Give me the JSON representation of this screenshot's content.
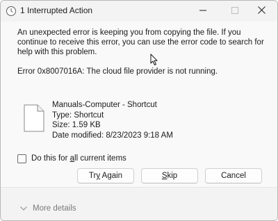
{
  "window": {
    "title": "1 Interrupted Action",
    "title_icon": "clock-icon",
    "controls": {
      "minimize": "minimize-icon",
      "maximize": "maximize-icon",
      "close": "close-icon"
    }
  },
  "dialog": {
    "message": "An unexpected error is keeping you from copying the file. If you continue to receive this error, you can use the error code to search for help with this problem.",
    "error_code": "Error 0x8007016A: The cloud file provider is not running."
  },
  "file": {
    "name": "Manuals-Computer - Shortcut",
    "type": "Type: Shortcut",
    "size": "Size: 1.59 KB",
    "date_modified": "Date modified: 8/23/2023 9:18 AM",
    "icon": "document-icon"
  },
  "checkbox": {
    "label_before": "Do this for ",
    "label_access_key": "a",
    "label_after": "ll current items",
    "checked": false
  },
  "buttons": {
    "try_again": {
      "before": "Tr",
      "key": "y",
      "after": " Again"
    },
    "skip": {
      "before": "",
      "key": "S",
      "after": "kip"
    },
    "cancel": "Cancel"
  },
  "footer": {
    "more_details": "More details",
    "icon": "chevron-down-icon"
  },
  "colors": {
    "title_bar": "#f3f3f3",
    "content_bg": "#f9f9f9",
    "button_bg": "#fdfdfd",
    "muted_text": "#7a7a7a"
  }
}
